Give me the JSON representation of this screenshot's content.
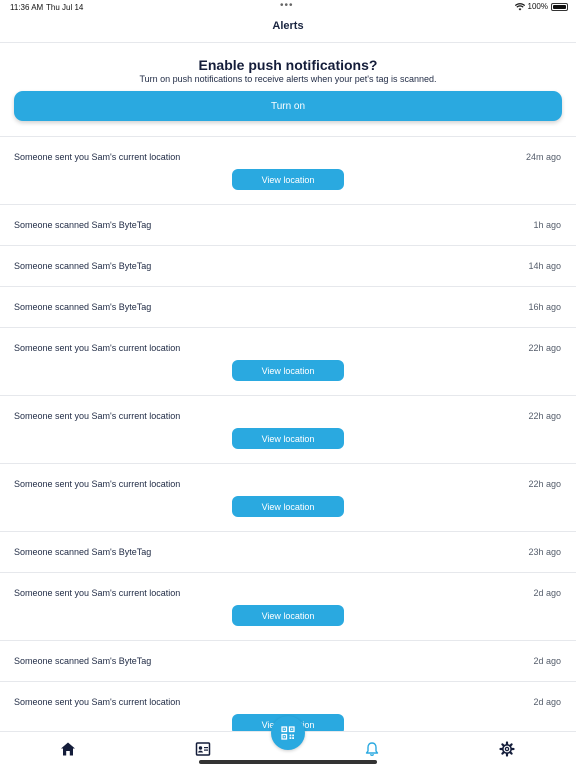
{
  "status_bar": {
    "time": "11:36 AM",
    "date": "Thu Jul 14",
    "battery": "100%"
  },
  "nav": {
    "title": "Alerts"
  },
  "push_prompt": {
    "title": "Enable push notifications?",
    "subtitle": "Turn on push notifications to receive alerts when your pet's tag is scanned.",
    "button_label": "Turn on"
  },
  "alerts": [
    {
      "message": "Someone sent you Sam's current location",
      "time": "24m ago",
      "action": "View location"
    },
    {
      "message": "Someone scanned Sam's ByteTag",
      "time": "1h ago"
    },
    {
      "message": "Someone scanned Sam's ByteTag",
      "time": "14h ago"
    },
    {
      "message": "Someone scanned Sam's ByteTag",
      "time": "16h ago"
    },
    {
      "message": "Someone sent you Sam's current location",
      "time": "22h ago",
      "action": "View location"
    },
    {
      "message": "Someone sent you Sam's current location",
      "time": "22h ago",
      "action": "View location"
    },
    {
      "message": "Someone sent you Sam's current location",
      "time": "22h ago",
      "action": "View location"
    },
    {
      "message": "Someone scanned Sam's ByteTag",
      "time": "23h ago"
    },
    {
      "message": "Someone sent you Sam's current location",
      "time": "2d ago",
      "action": "View location"
    },
    {
      "message": "Someone scanned Sam's ByteTag",
      "time": "2d ago"
    },
    {
      "message": "Someone sent you Sam's current location",
      "time": "2d ago",
      "action": "View location"
    }
  ],
  "tabs": [
    {
      "icon": "home-icon"
    },
    {
      "icon": "profile-card-icon"
    },
    {
      "icon": "qr-scan-icon"
    },
    {
      "icon": "bell-icon"
    },
    {
      "icon": "gear-icon"
    }
  ],
  "colors": {
    "accent": "#2aa9e0",
    "text": "#1f2a44",
    "divider": "#e6e8ec"
  }
}
